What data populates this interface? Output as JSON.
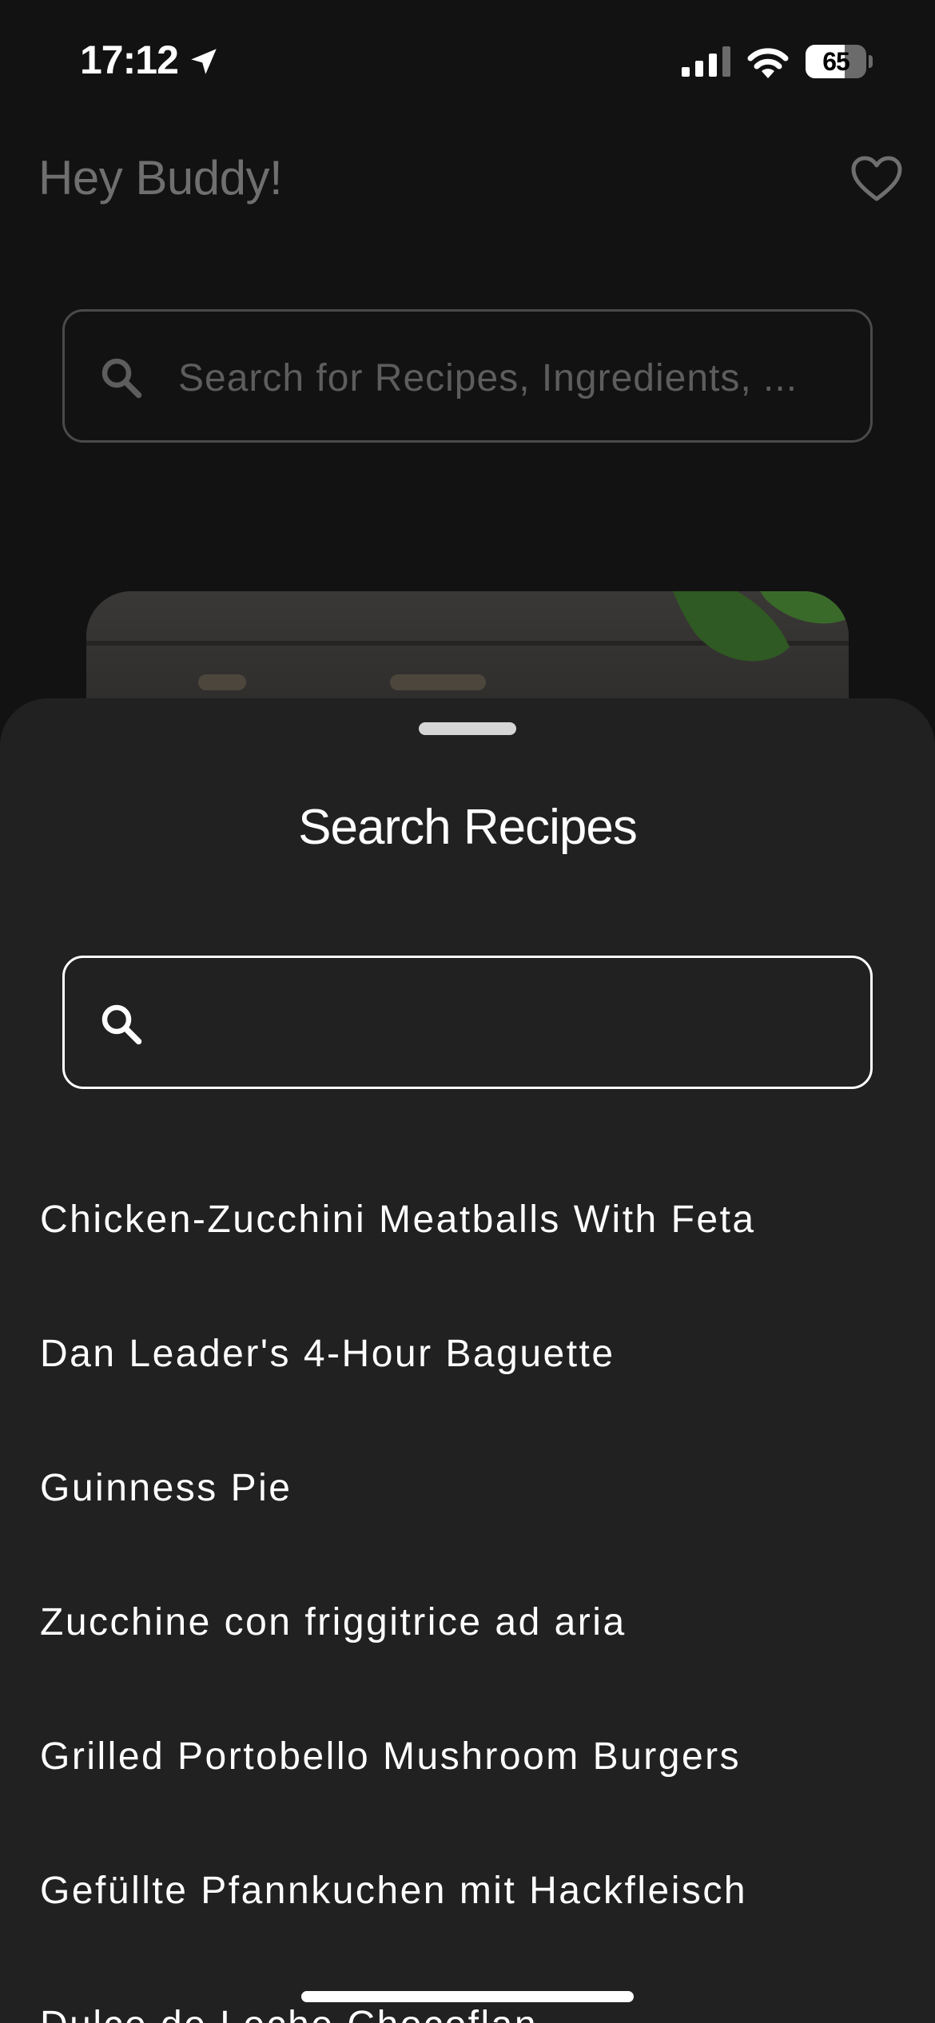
{
  "status_bar": {
    "time": "17:12",
    "battery_level": "65",
    "battery_fraction": 0.65
  },
  "header": {
    "greeting": "Hey Buddy!"
  },
  "background_search": {
    "placeholder": "Search for Recipes, Ingredients, ..."
  },
  "sheet": {
    "title": "Search Recipes",
    "search_value": "",
    "results": [
      "Chicken-Zucchini Meatballs With Feta",
      "Dan Leader's 4-Hour Baguette",
      "Guinness Pie",
      "Zucchine con friggitrice ad aria",
      "Grilled Portobello Mushroom Burgers",
      "Gefüllte Pfannkuchen mit Hackfleisch",
      "Dulce de Leche Chocoflan"
    ]
  },
  "icons": {
    "location": "location-arrow-icon",
    "signal": "cellular-signal-icon",
    "wifi": "wifi-icon",
    "favorites": "heart-icon",
    "search": "search-icon"
  },
  "colors": {
    "sheet_background": "#212122",
    "app_background": "#121213",
    "text_primary": "#ffffff",
    "text_dimmed": "#6f6f70"
  }
}
